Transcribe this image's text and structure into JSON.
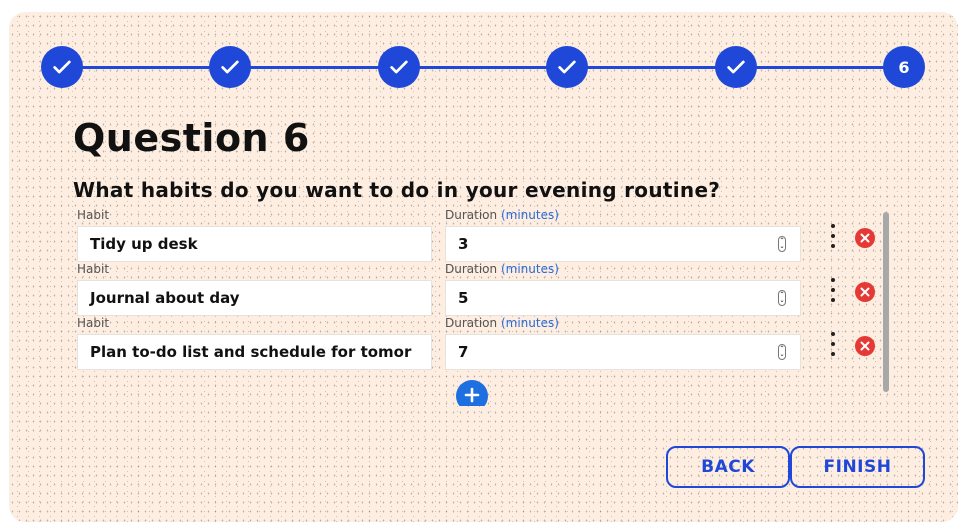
{
  "stepper": {
    "steps": [
      {
        "state": "done",
        "icon": "check-icon"
      },
      {
        "state": "done",
        "icon": "check-icon"
      },
      {
        "state": "done",
        "icon": "check-icon"
      },
      {
        "state": "done",
        "icon": "check-icon"
      },
      {
        "state": "done",
        "icon": "check-icon"
      },
      {
        "state": "current",
        "label": "6"
      }
    ],
    "color": "#1f48d8"
  },
  "question": {
    "title": "Question 6",
    "prompt": "What habits do you want to do in your evening routine?"
  },
  "labels": {
    "habit": "Habit",
    "duration": "Duration",
    "unit": "(minutes)"
  },
  "habits": [
    {
      "name": "Tidy up desk",
      "duration": "3"
    },
    {
      "name": "Journal about day",
      "duration": "5"
    },
    {
      "name": "Plan to-do list and schedule for tomor",
      "duration": "7"
    }
  ],
  "buttons": {
    "back": "BACK",
    "finish": "FINISH"
  },
  "colors": {
    "accent": "#1f48d8",
    "remove": "#e53935",
    "add": "#1e6fe0",
    "background": "#fdeee1"
  }
}
